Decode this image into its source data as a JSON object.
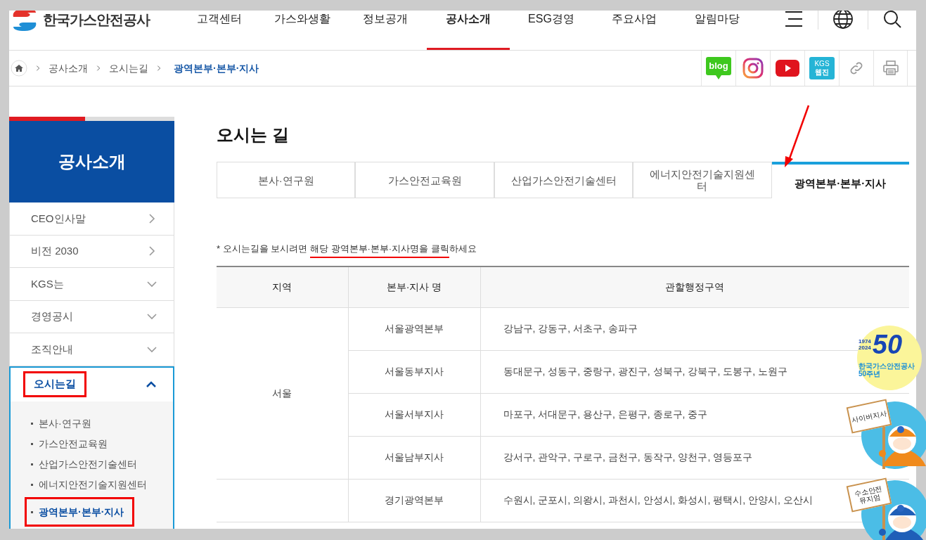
{
  "header": {
    "logo": "한국가스안전공사",
    "nav": [
      {
        "label": "고객센터",
        "selected": false
      },
      {
        "label": "가스와생활",
        "selected": false
      },
      {
        "label": "정보공개",
        "selected": false
      },
      {
        "label": "공사소개",
        "selected": true
      },
      {
        "label": "ESG경영",
        "selected": false
      },
      {
        "label": "주요사업",
        "selected": false
      },
      {
        "label": "알림마당",
        "selected": false
      }
    ]
  },
  "breadcrumb": {
    "items": [
      {
        "label": "공사소개",
        "current": false
      },
      {
        "label": "오시는길",
        "current": false
      },
      {
        "label": "광역본부·본부·지사",
        "current": true
      }
    ],
    "social": [
      {
        "kind": "blog",
        "label": "blog"
      },
      {
        "kind": "instagram"
      },
      {
        "kind": "youtube"
      },
      {
        "kind": "webzine",
        "lines": [
          "KGS",
          "웹진"
        ]
      },
      {
        "kind": "link"
      },
      {
        "kind": "print"
      }
    ]
  },
  "sidebar": {
    "title": "공사소개",
    "items": [
      {
        "label": "CEO인사말",
        "kind": "link",
        "marked": false
      },
      {
        "label": "비전 2030",
        "kind": "link",
        "marked": false
      },
      {
        "label": "KGS는",
        "kind": "group",
        "expanded": false,
        "marked": false
      },
      {
        "label": "경영공시",
        "kind": "group",
        "expanded": false,
        "marked": false
      },
      {
        "label": "조직안내",
        "kind": "group",
        "expanded": false,
        "marked": false
      },
      {
        "label": "오시는길",
        "kind": "group",
        "expanded": true,
        "marked": true,
        "children": [
          {
            "label": "본사·연구원",
            "selected": false,
            "marked": false
          },
          {
            "label": "가스안전교육원",
            "selected": false,
            "marked": false
          },
          {
            "label": "산업가스안전기술센터",
            "selected": false,
            "marked": false
          },
          {
            "label": "에너지안전기술지원센터",
            "selected": false,
            "marked": false
          },
          {
            "label": "광역본부·본부·지사",
            "selected": true,
            "marked": true
          }
        ]
      }
    ]
  },
  "content": {
    "title": "오시는 길",
    "tabs": [
      {
        "label": "본사·연구원",
        "selected": false,
        "marked": false
      },
      {
        "label": "가스안전교육원",
        "selected": false,
        "marked": false
      },
      {
        "label": "산업가스안전기술센터",
        "selected": false,
        "marked": false
      },
      {
        "label": "에너지안전기술지원센터",
        "selected": false,
        "marked": false
      },
      {
        "label": "광역본부·본부·지사",
        "selected": true,
        "marked": true
      }
    ],
    "note": {
      "before": "* 오시는길을 보시려면 ",
      "marked": "해당 광역본부·본부·지사명을 클릭",
      "after": "하세요"
    },
    "table": {
      "columns": [
        "지역",
        "본부·지사 명",
        "관할행정구역"
      ],
      "groups": [
        {
          "region": "서울",
          "rows": [
            {
              "name": "서울광역본부",
              "area": "강남구, 강동구, 서초구, 송파구"
            },
            {
              "name": "서울동부지사",
              "area": "동대문구, 성동구, 중랑구, 광진구, 성북구, 강북구, 도봉구, 노원구"
            },
            {
              "name": "서울서부지사",
              "area": "마포구, 서대문구, 용산구, 은평구, 종로구, 중구"
            },
            {
              "name": "서울남부지사",
              "area": "강서구, 관악구, 구로구, 금천구, 동작구, 양천구, 영등포구"
            }
          ]
        },
        {
          "rows": [
            {
              "name": "경기광역본부",
              "area": "수원시, 군포시, 의왕시, 과천시, 안성시, 화성시, 평택시, 안양시, 오산시"
            }
          ]
        }
      ]
    }
  },
  "anniversary_badge": {
    "number": "50",
    "years": [
      "1974",
      "2024"
    ],
    "lines": [
      "한국가스안전공사",
      "50주년"
    ]
  },
  "mascot_badges": [
    {
      "sign": [
        "사이버지사"
      ],
      "color": "#f08a1c"
    },
    {
      "sign": [
        "수소안전",
        "뮤지엄"
      ],
      "color": "#1f5fb8"
    }
  ]
}
